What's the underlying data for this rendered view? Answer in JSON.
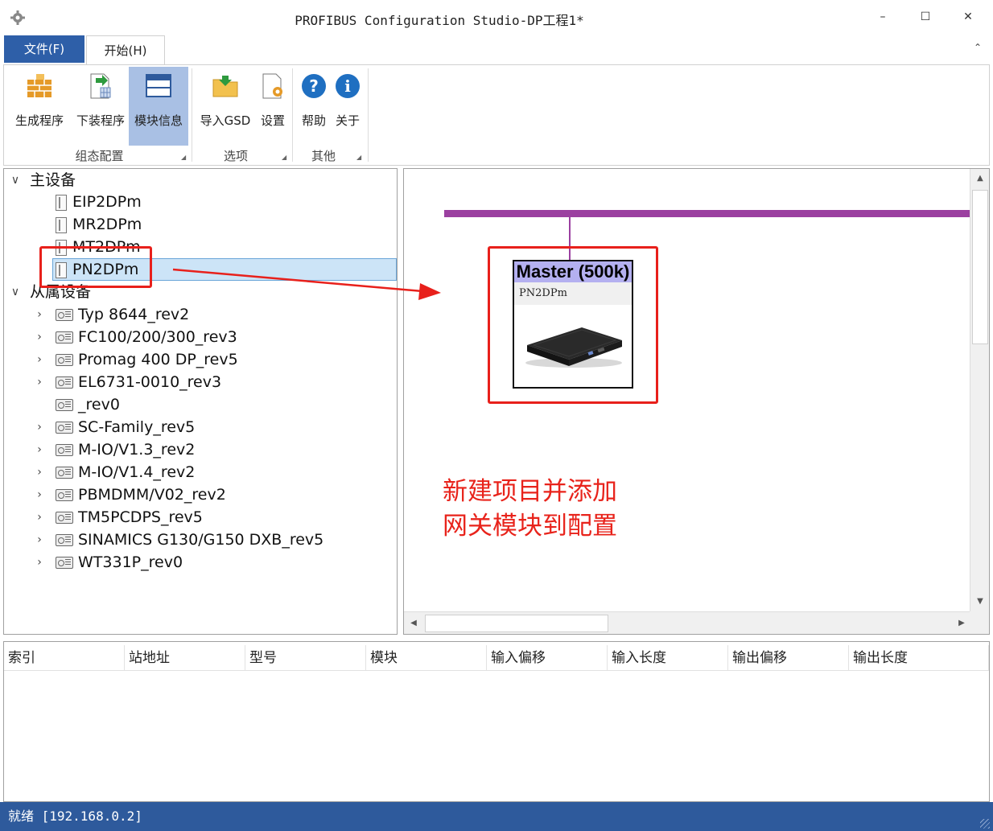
{
  "window": {
    "title": "PROFIBUS Configuration Studio-DP工程1*",
    "minimize": "–",
    "maximize": "☐",
    "close": "✕"
  },
  "tabs": {
    "file": "文件(F)",
    "start": "开始(H)",
    "collapse": "⌃"
  },
  "ribbon": {
    "groups": [
      {
        "label": "组态配置",
        "buttons": [
          "生成程序",
          "下装程序",
          "模块信息"
        ]
      },
      {
        "label": "选项",
        "buttons": [
          "导入GSD",
          "设置"
        ]
      },
      {
        "label": "其他",
        "buttons": [
          "帮助",
          "关于"
        ]
      }
    ],
    "active_button": "模块信息"
  },
  "tree": {
    "master_header": "主设备",
    "masters": [
      "EIP2DPm",
      "MR2DPm",
      "MT2DPm",
      "PN2DPm"
    ],
    "selected_master": "PN2DPm",
    "slave_header": "从属设备",
    "slaves": [
      "Typ 8644_rev2",
      "FC100/200/300_rev3",
      "Promag 400 DP_rev5",
      "EL6731-0010_rev3",
      "_rev0",
      "SC-Family_rev5",
      "M-IO/V1.3_rev2",
      "M-IO/V1.4_rev2",
      "PBMDMM/V02_rev2",
      "TM5PCDPS_rev5",
      "SINAMICS G130/G150 DXB_rev5",
      "WT331P_rev0"
    ]
  },
  "canvas": {
    "master_title": "Master (500k)",
    "master_module": "PN2DPm",
    "note_line1": "新建项目并添加",
    "note_line2": "网关模块到配置",
    "bus_color": "#9b40a0",
    "highlight_color": "#e8201b"
  },
  "table": {
    "columns": [
      "索引",
      "站地址",
      "型号",
      "模块",
      "输入偏移",
      "输入长度",
      "输出偏移",
      "输出长度"
    ]
  },
  "status": {
    "text": "就绪 [192.168.0.2]"
  }
}
